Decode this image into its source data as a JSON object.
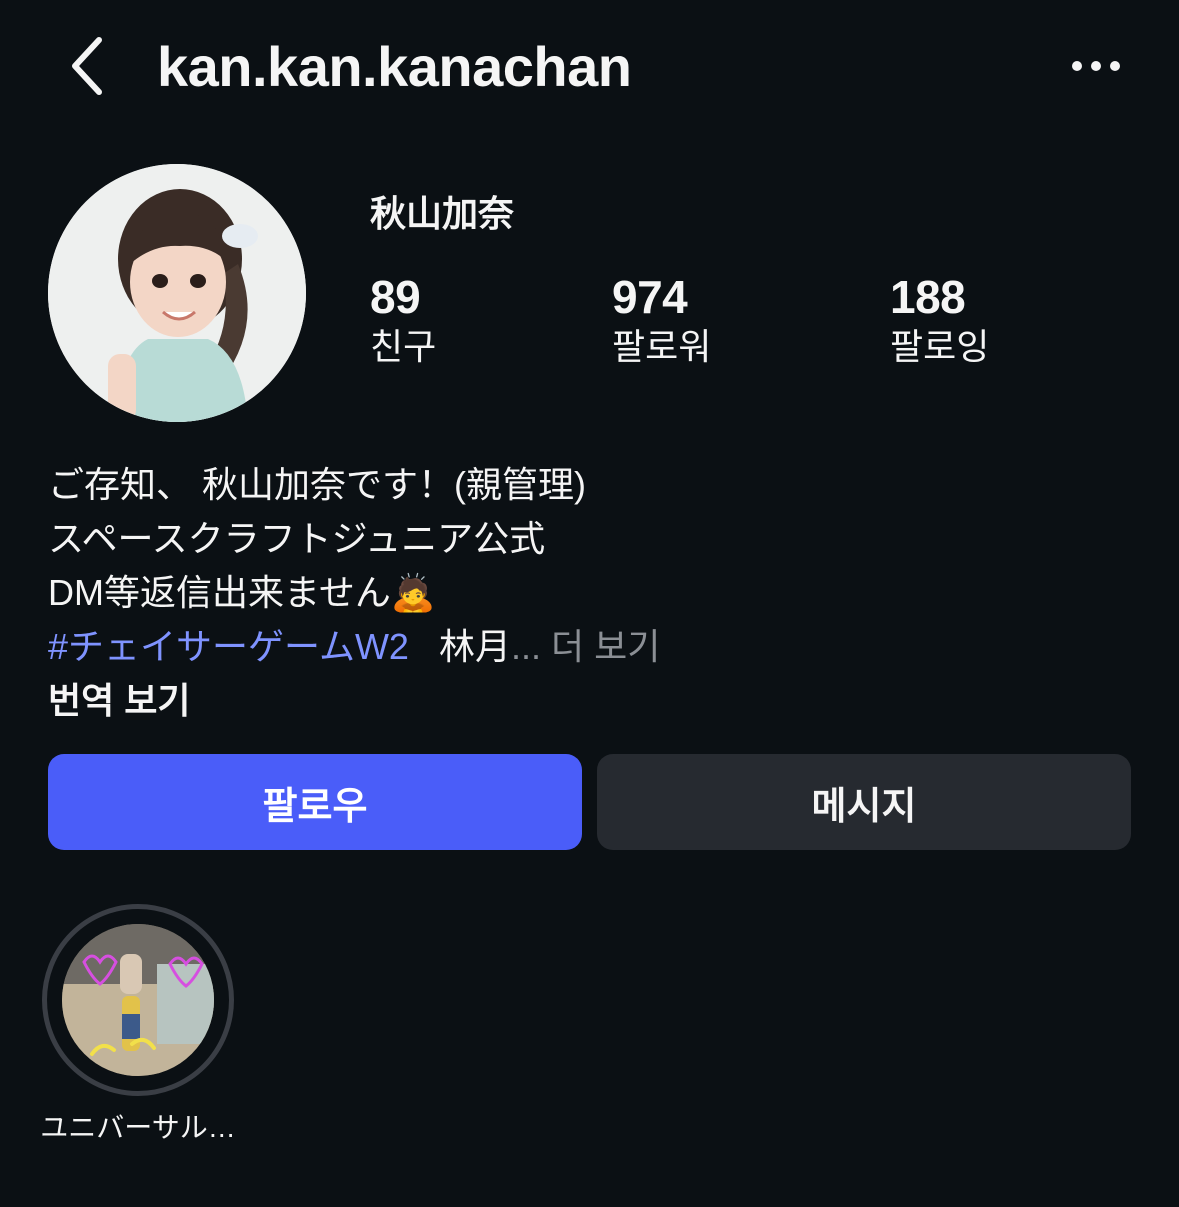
{
  "header": {
    "back_icon": "chevron-left-icon",
    "username": "kan.kan.kanachan",
    "more_icon": "more-horizontal-icon"
  },
  "profile": {
    "display_name": "秋山加奈",
    "stats": [
      {
        "value": "89",
        "label": "친구"
      },
      {
        "value": "974",
        "label": "팔로워"
      },
      {
        "value": "188",
        "label": "팔로잉"
      }
    ]
  },
  "bio": {
    "line1": "ご存知、 秋山加奈です！(親管理)",
    "line2": "スペースクラフトジュニア公式",
    "line3": "DM等返信出来ません",
    "line3_emoji": "🙇",
    "hashtag": "#チェイサーゲームW2",
    "line4_text": "林月",
    "ellipsis": "...",
    "more_label": "더 보기",
    "translate_label": "번역 보기"
  },
  "actions": {
    "follow_label": "팔로우",
    "message_label": "메시지"
  },
  "highlights": [
    {
      "label": "ユニバーサル…"
    }
  ],
  "colors": {
    "background": "#0b1014",
    "accent_button": "#4a5df9",
    "hashtag": "#7f93ff",
    "secondary_button": "#262a30"
  }
}
